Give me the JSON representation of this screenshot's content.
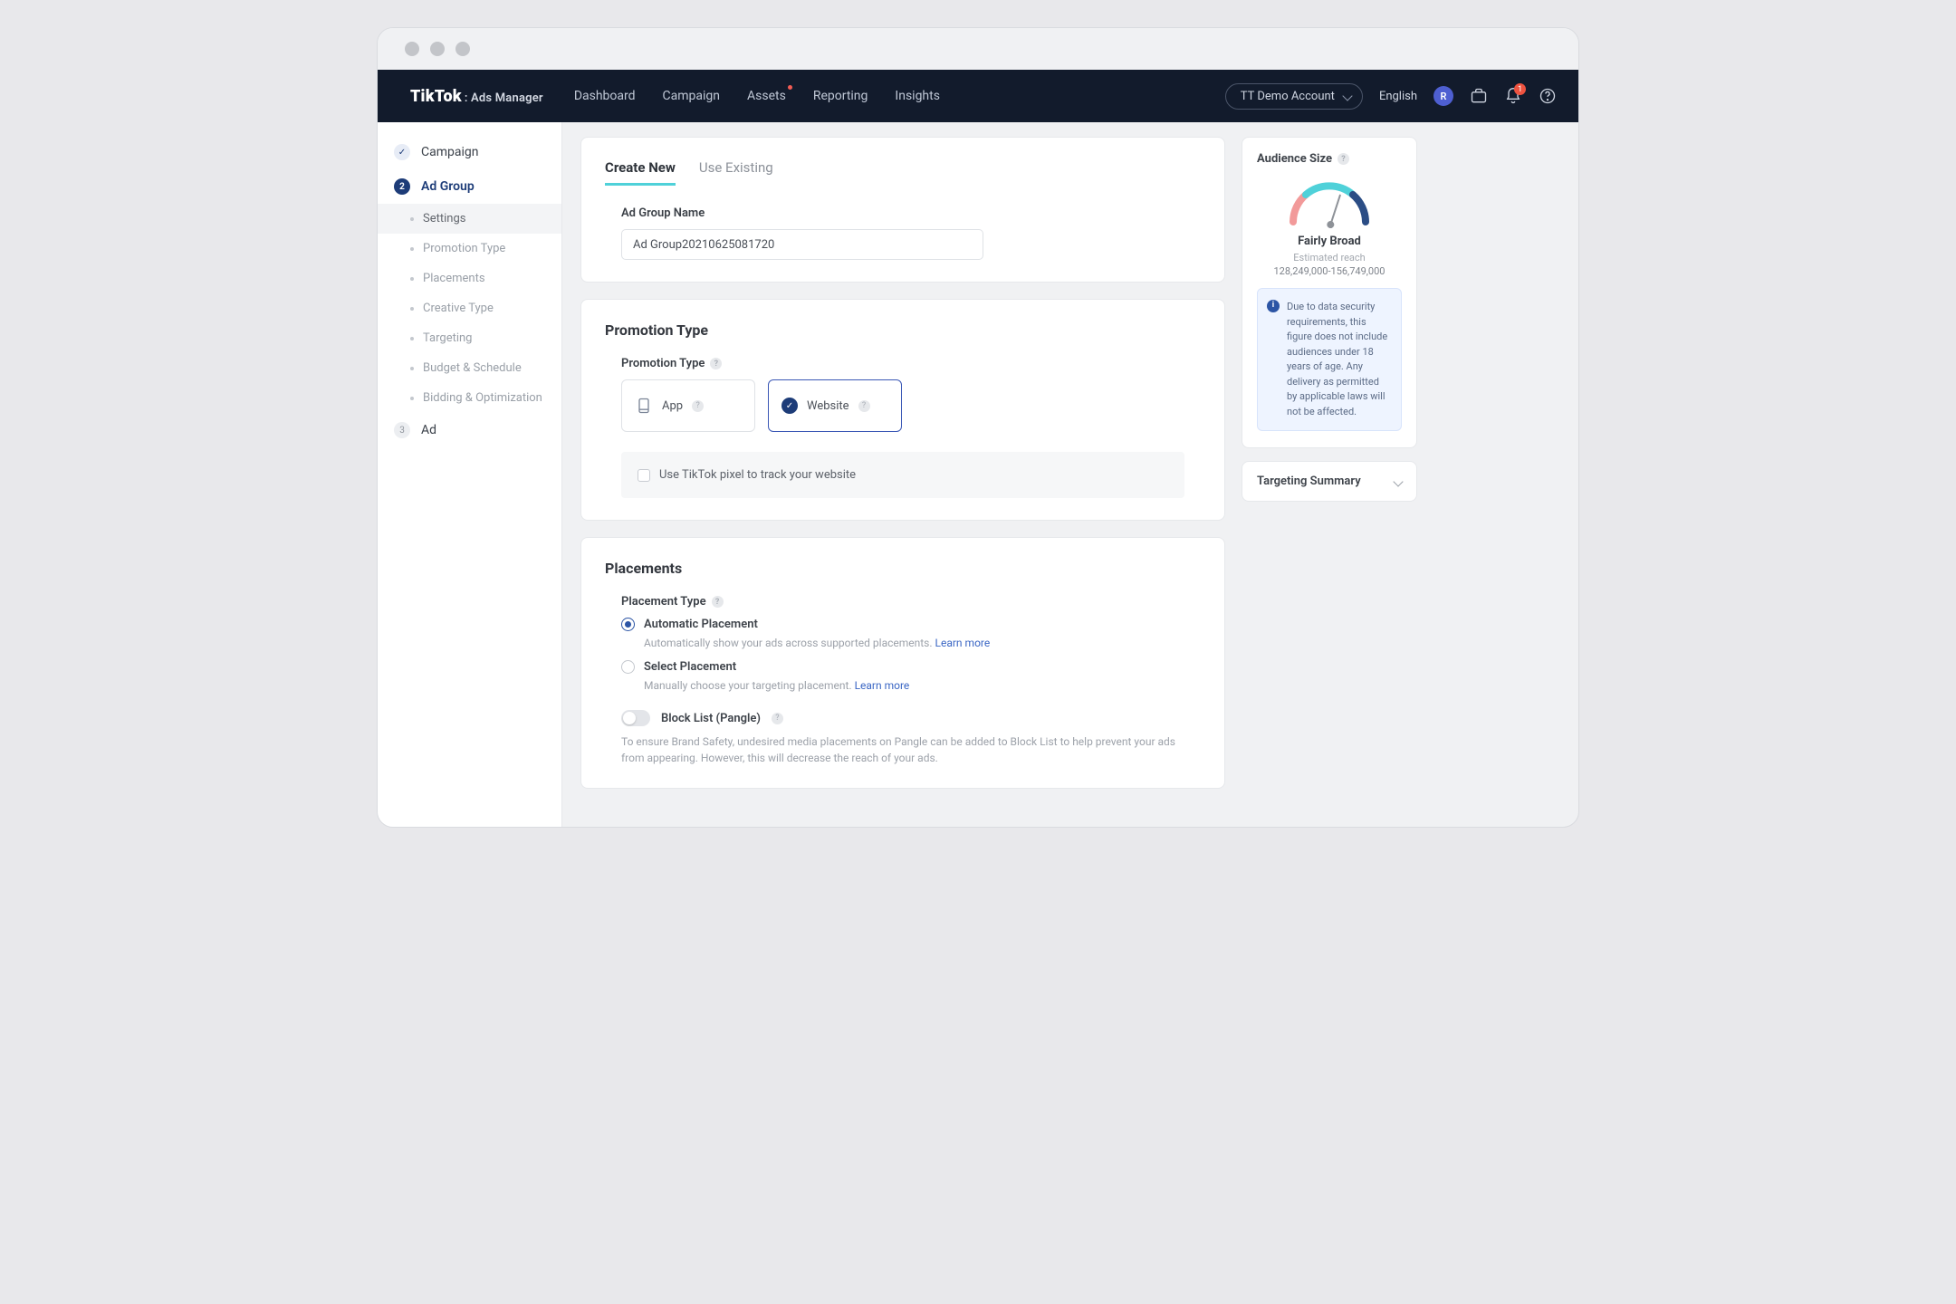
{
  "brand": {
    "name": "TikTok",
    "suffix": ": Ads Manager"
  },
  "nav": {
    "items": [
      "Dashboard",
      "Campaign",
      "Assets",
      "Reporting",
      "Insights"
    ],
    "account": "TT Demo Account",
    "language": "English",
    "avatar_initial": "R",
    "notif_badge": "1"
  },
  "sidebar": {
    "steps": [
      {
        "label": "Campaign"
      },
      {
        "num": "2",
        "label": "Ad Group"
      },
      {
        "num": "3",
        "label": "Ad"
      }
    ],
    "substeps": [
      "Settings",
      "Promotion Type",
      "Placements",
      "Creative Type",
      "Targeting",
      "Budget & Schedule",
      "Bidding & Optimization"
    ]
  },
  "tabs": {
    "create": "Create New",
    "use": "Use Existing"
  },
  "adgroup": {
    "name_label": "Ad Group Name",
    "name_value": "Ad Group20210625081720"
  },
  "promotion": {
    "title": "Promotion Type",
    "label": "Promotion Type",
    "opt_app": "App",
    "opt_website": "Website",
    "pixel_text": "Use TikTok pixel to track your website"
  },
  "placements": {
    "title": "Placements",
    "type_label": "Placement Type",
    "auto_label": "Automatic Placement",
    "auto_desc": "Automatically show your ads across supported placements. ",
    "select_label": "Select Placement",
    "select_desc": "Manually choose your targeting placement. ",
    "learn_more": "Learn more",
    "block_label": "Block List (Pangle)",
    "block_desc": "To ensure Brand Safety, undesired media placements on Pangle can be added to Block List to help prevent your ads from appearing. However, this will decrease the reach of your ads."
  },
  "audience": {
    "title": "Audience Size",
    "status": "Fairly Broad",
    "sub": "Estimated reach",
    "range": "128,249,000-156,749,000",
    "info": "Due to data security requirements, this figure does not include audiences under 18 years of age. Any delivery as permitted by applicable laws will not be affected."
  },
  "targeting_summary": "Targeting Summary"
}
